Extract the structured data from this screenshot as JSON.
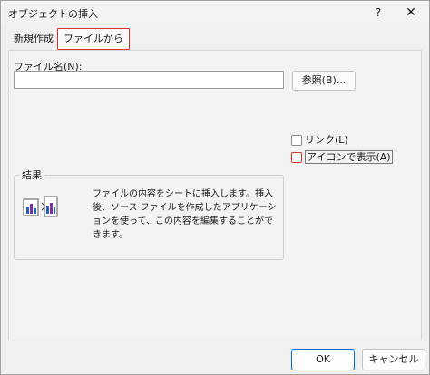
{
  "window": {
    "title": "オブジェクトの挿入",
    "help_label": "?",
    "close_label": "✕"
  },
  "tabs": [
    {
      "label": "新規作成",
      "selected": false
    },
    {
      "label": "ファイルから",
      "selected": true
    }
  ],
  "file_panel": {
    "filename_label": "ファイル名(N):",
    "filename_value": "",
    "browse_label": "参照(B)..."
  },
  "options": {
    "link_label": "リンク(L)",
    "link_checked": false,
    "display_as_icon_label": "アイコンで表示(A)",
    "display_as_icon_checked": false
  },
  "result": {
    "title": "結果",
    "description": "ファイルの内容をシートに挿入します。挿入後、ソース ファイルを作成したアプリケーションを使って、この内容を編集することができます。",
    "icon": "insert-file-icon"
  },
  "buttons": {
    "ok_label": "OK",
    "cancel_label": "キャンセル"
  },
  "colors": {
    "highlight": "#d9342b",
    "ok_border": "#0a64c8"
  }
}
